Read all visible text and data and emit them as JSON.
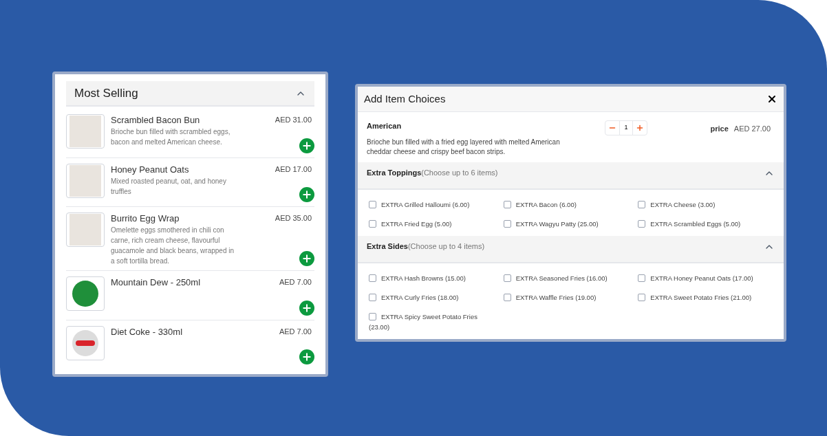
{
  "most_selling": {
    "title": "Most Selling",
    "expanded": true,
    "items": [
      {
        "name": "Scrambled Bacon Bun",
        "description": "Brioche bun filled with scrambled eggs, bacon and melted American cheese.",
        "price": "AED 31.00",
        "kind": "photo"
      },
      {
        "name": "Honey Peanut Oats",
        "description": "Mixed roasted peanut, oat, and honey truffles",
        "price": "AED 17.00",
        "kind": "photo"
      },
      {
        "name": "Burrito Egg Wrap",
        "description": "Omelette eggs smothered in chili con carne, rich cream cheese, flavourful guacamole and black beans, wrapped in a soft tortilla bread.",
        "price": "AED 35.00",
        "kind": "photo"
      },
      {
        "name": "Mountain Dew - 250ml",
        "price": "AED 7.00",
        "kind": "green-logo"
      },
      {
        "name": "Diet Coke - 330ml",
        "price": "AED 7.00",
        "kind": "red-logo"
      }
    ]
  },
  "dialog": {
    "title": "Add Item Choices",
    "item": {
      "name": "American",
      "description": "Brioche bun filled with a fried egg layered with melted American cheddar cheese and crispy beef bacon strips.",
      "quantity": "1",
      "price_label": "price",
      "price": "AED 27.00"
    },
    "sections": [
      {
        "title": "Extra Toppings",
        "hint": "(Choose up to 6 items)",
        "expanded": true,
        "options": [
          {
            "label": "EXTRA Grilled Halloumi (6.00)",
            "checked": false
          },
          {
            "label": "EXTRA Bacon (6.00)",
            "checked": false
          },
          {
            "label": "EXTRA Cheese (3.00)",
            "checked": false
          },
          {
            "label": "EXTRA Fried Egg (5.00)",
            "checked": false
          },
          {
            "label": "EXTRA Wagyu Patty (25.00)",
            "checked": false
          },
          {
            "label": "EXTRA Scrambled Eggs (5.00)",
            "checked": false
          }
        ]
      },
      {
        "title": "Extra Sides",
        "hint": "(Choose up to 4 items)",
        "expanded": true,
        "options": [
          {
            "label": "EXTRA Hash Browns (15.00)",
            "checked": false
          },
          {
            "label": "EXTRA Seasoned Fries (16.00)",
            "checked": false
          },
          {
            "label": "EXTRA Honey Peanut Oats (17.00)",
            "checked": false
          },
          {
            "label": "EXTRA Curly Fries (18.00)",
            "checked": false
          },
          {
            "label": "EXTRA Waffle Fries (19.00)",
            "checked": false
          },
          {
            "label": "EXTRA Sweet Potato Fries (21.00)",
            "checked": false
          },
          {
            "label": "EXTRA Spicy Sweet Potato Fries (23.00)",
            "checked": false
          }
        ]
      }
    ]
  }
}
